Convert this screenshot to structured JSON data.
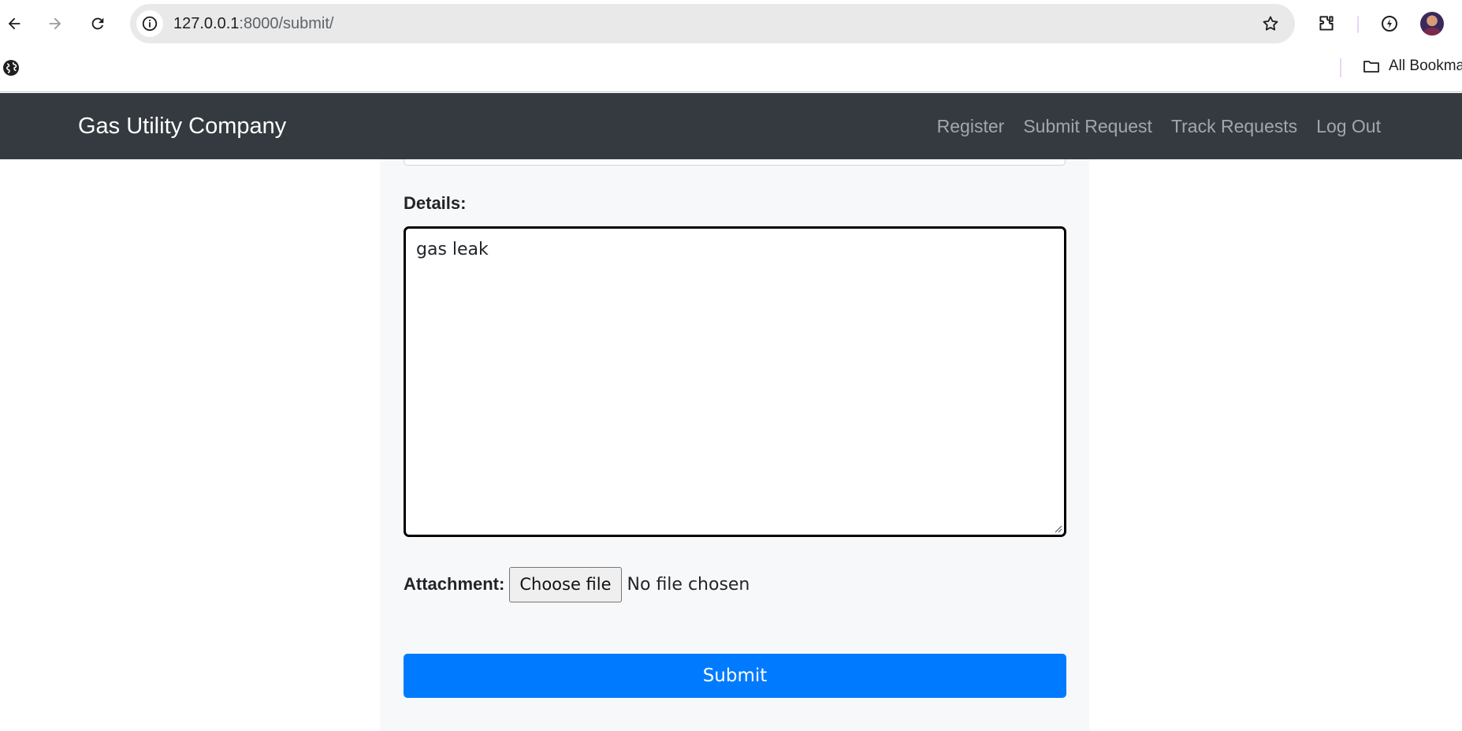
{
  "browser": {
    "url_host": "127.0.0.1",
    "url_path": ":8000/submit/",
    "bookmarks_label": "All Bookmarks"
  },
  "navbar": {
    "brand": "Gas Utility Company",
    "links": [
      {
        "label": "Register"
      },
      {
        "label": "Submit Request"
      },
      {
        "label": "Track Requests"
      },
      {
        "label": "Log Out"
      }
    ]
  },
  "form": {
    "details_label": "Details:",
    "details_value": "gas leak",
    "attachment_label": "Attachment:",
    "choose_file_label": "Choose file",
    "no_file_text": "No file chosen",
    "submit_label": "Submit"
  },
  "colors": {
    "navbar_bg": "#343a40",
    "primary": "#007bff",
    "card_bg": "#f7f8f9"
  }
}
